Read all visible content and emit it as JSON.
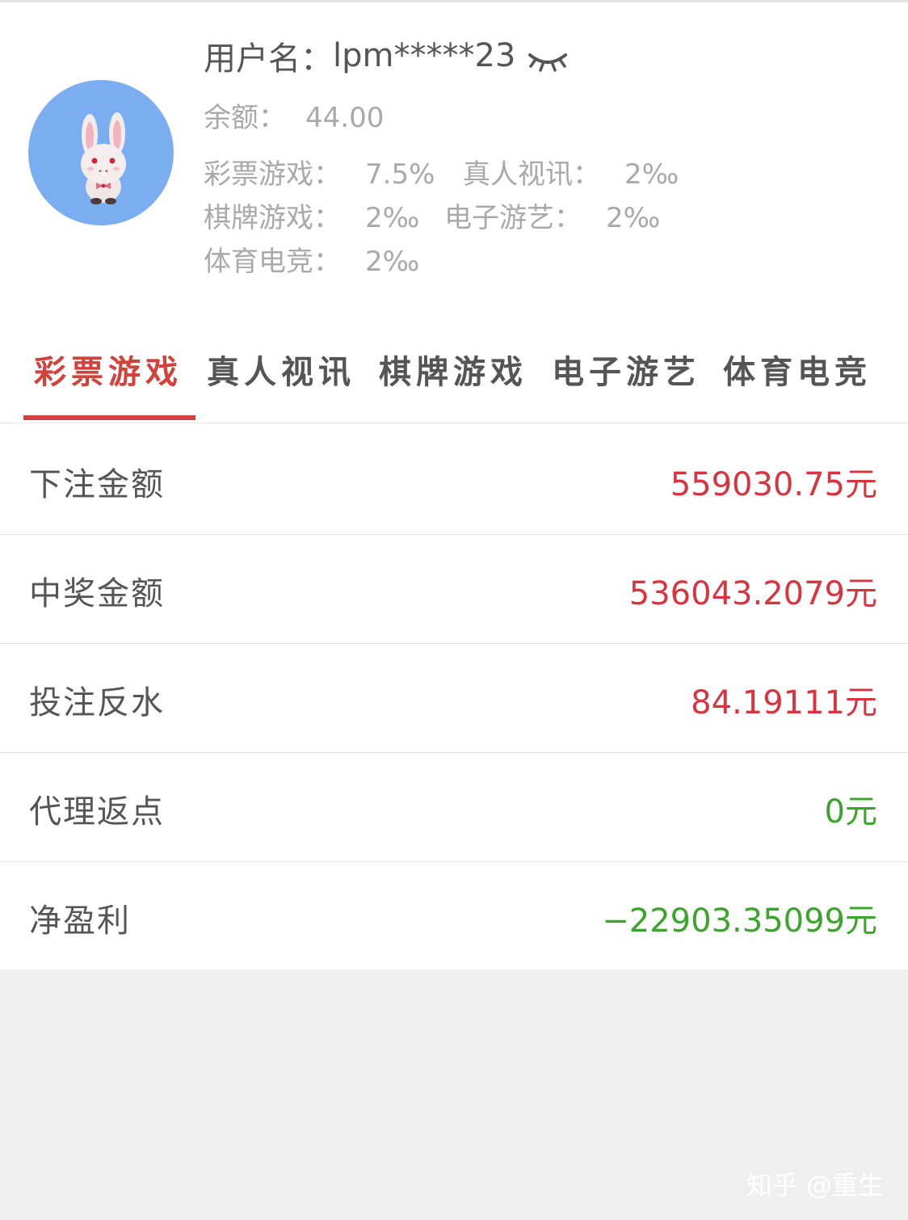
{
  "profile": {
    "username_label": "用户名：",
    "username": "lpm*****23",
    "balance_label": "余额：",
    "balance": "44.00",
    "rates": [
      {
        "label": "彩票游戏：",
        "value": "7.5%"
      },
      {
        "label": "真人视讯：",
        "value": "2‰"
      },
      {
        "label": "棋牌游戏：",
        "value": "2‰"
      },
      {
        "label": "电子游艺：",
        "value": "2‰"
      },
      {
        "label": "体育电竞：",
        "value": "2‰"
      }
    ]
  },
  "tabs": [
    {
      "label": "彩票游戏",
      "active": true
    },
    {
      "label": "真人视讯",
      "active": false
    },
    {
      "label": "棋牌游戏",
      "active": false
    },
    {
      "label": "电子游艺",
      "active": false
    },
    {
      "label": "体育电竞",
      "active": false
    }
  ],
  "stats": [
    {
      "label": "下注金额",
      "value": "559030.75元",
      "color": "#d9333f"
    },
    {
      "label": "中奖金额",
      "value": "536043.2079元",
      "color": "#d9333f"
    },
    {
      "label": "投注反水",
      "value": "84.19111元",
      "color": "#d9333f"
    },
    {
      "label": "代理返点",
      "value": "0元",
      "color": "#3aa52a"
    },
    {
      "label": "净盈利",
      "value": "−22903.35099元",
      "color": "#3aa52a"
    }
  ],
  "watermark": "知乎 @重生",
  "colors": {
    "accent": "#d2423b",
    "avatar_bg": "#7aaef0"
  }
}
